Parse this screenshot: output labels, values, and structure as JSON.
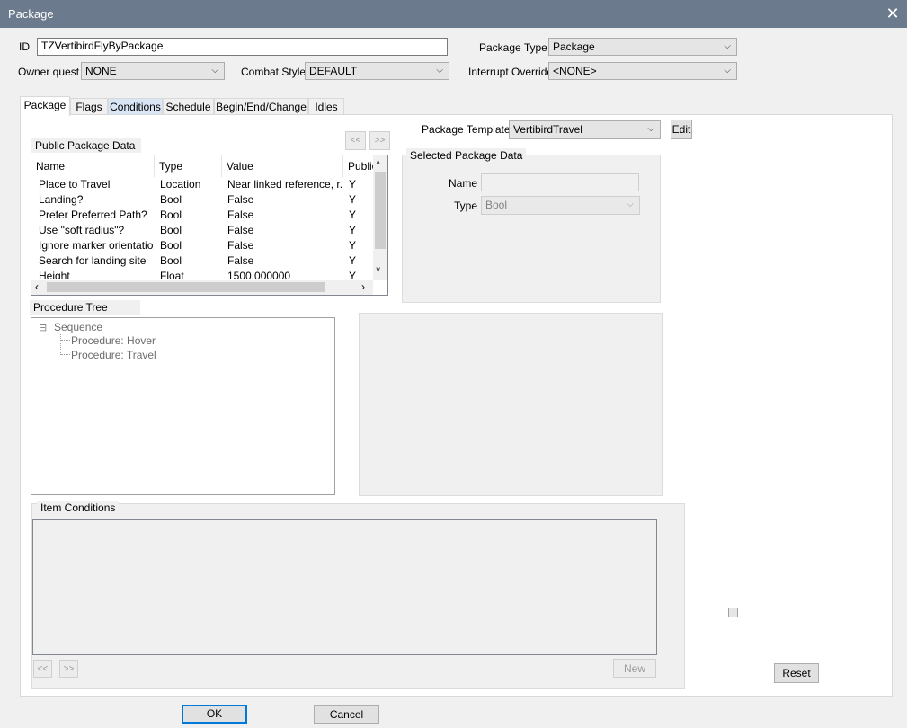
{
  "window": {
    "title": "Package",
    "close_glyph": "✕"
  },
  "header": {
    "id_label": "ID",
    "id_value": "TZVertibirdFlyByPackage",
    "package_type_label": "Package Type",
    "package_type_value": "Package",
    "owner_quest_label": "Owner quest",
    "owner_quest_value": "NONE",
    "combat_style_label": "Combat Style",
    "combat_style_value": "DEFAULT",
    "interrupt_override_label": "Interrupt Override",
    "interrupt_override_value": "<NONE>"
  },
  "tabs": [
    {
      "label": "Package"
    },
    {
      "label": "Flags"
    },
    {
      "label": "Conditions"
    },
    {
      "label": "Schedule"
    },
    {
      "label": "Begin/End/Change"
    },
    {
      "label": "Idles"
    }
  ],
  "package_template": {
    "label": "Package Template",
    "value": "VertibirdTravel",
    "edit_label": "Edit"
  },
  "public_data": {
    "title": "Public Package Data",
    "prev_label": "<<",
    "next_label": ">>",
    "columns": [
      "Name",
      "Type",
      "Value",
      "Public"
    ],
    "rows": [
      [
        "Place to Travel",
        "Location",
        "Near linked reference, r...",
        "Y"
      ],
      [
        "Landing?",
        "Bool",
        "False",
        "Y"
      ],
      [
        "Prefer Preferred Path?",
        "Bool",
        "False",
        "Y"
      ],
      [
        "Use \"soft radius\"?",
        "Bool",
        "False",
        "Y"
      ],
      [
        "Ignore marker orientation?",
        "Bool",
        "False",
        "Y"
      ],
      [
        "Search for landing site",
        "Bool",
        "False",
        "Y"
      ],
      [
        "Height",
        "Float",
        "1500.000000",
        "Y"
      ]
    ]
  },
  "selected_data": {
    "title": "Selected Package Data",
    "name_label": "Name",
    "name_value": "",
    "type_label": "Type",
    "type_value": "Bool"
  },
  "procedure_tree": {
    "title": "Procedure Tree",
    "root": "Sequence",
    "expander": "⊟",
    "children": [
      "Procedure: Hover",
      "Procedure: Travel"
    ]
  },
  "item_conditions": {
    "title": "Item Conditions",
    "prev_label": "<<",
    "next_label": ">>",
    "new_label": "New"
  },
  "reset_label": "Reset",
  "footer": {
    "ok_label": "OK",
    "cancel_label": "Cancel"
  }
}
